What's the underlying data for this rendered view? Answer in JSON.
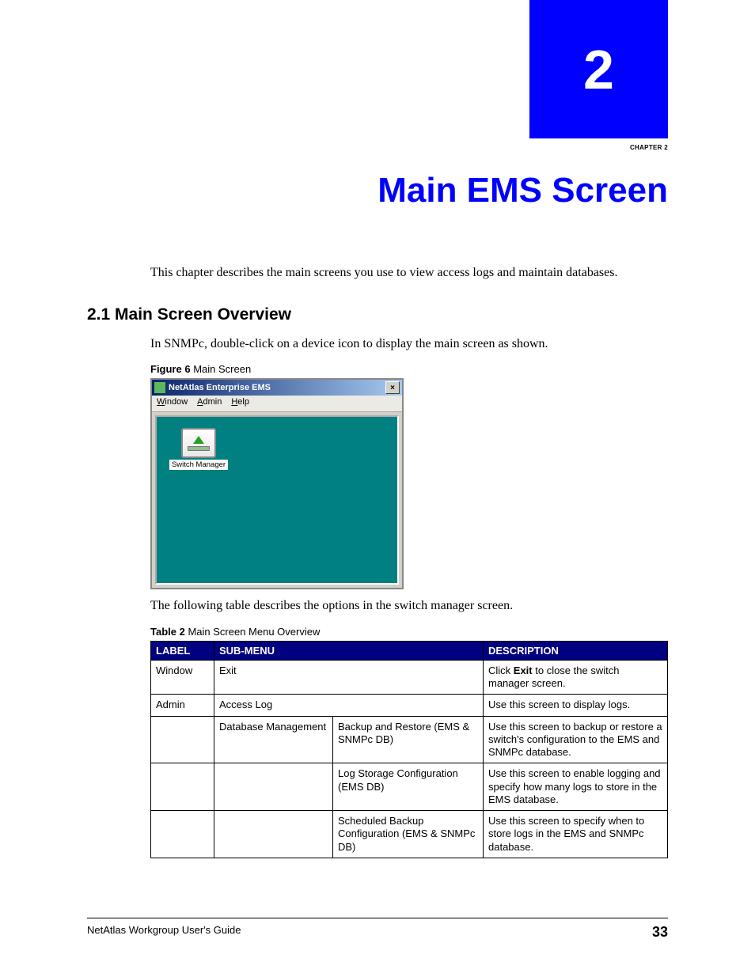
{
  "chapter": {
    "number": "2",
    "label": "CHAPTER  2",
    "title": "Main EMS Screen"
  },
  "intro": "This chapter describes the main screens you use to view access logs and maintain databases.",
  "section": {
    "number_title": "2.1  Main Screen Overview",
    "body1": "In SNMPc, double-click on a device icon to display the main screen as shown.",
    "body2": "The following table describes the options in the switch manager screen."
  },
  "figure": {
    "caption_prefix": "Figure 6",
    "caption_text": "   Main Screen",
    "window_title": "NetAtlas Enterprise EMS",
    "menu": {
      "m1": "Window",
      "m2": "Admin",
      "m3": "Help"
    },
    "icon_label": "Switch Manager",
    "close_glyph": "×"
  },
  "table": {
    "caption_prefix": "Table 2",
    "caption_text": "   Main Screen Menu Overview",
    "headers": {
      "h1": "LABEL",
      "h2": "SUB-MENU",
      "h3": "DESCRIPTION"
    },
    "rows": [
      {
        "label": "Window",
        "sub1": "Exit",
        "sub2": "",
        "desc_pre": "Click ",
        "desc_bold": "Exit",
        "desc_post": " to close the switch manager screen."
      },
      {
        "label": "Admin",
        "sub1": "Access Log",
        "sub2": "",
        "desc": "Use this screen to display logs."
      },
      {
        "label": "",
        "sub1": "Database Management",
        "sub2": "Backup and Restore (EMS & SNMPc DB)",
        "desc": "Use this screen to backup or restore a switch's configuration to the EMS and SNMPc database."
      },
      {
        "label": "",
        "sub1": "",
        "sub2": "Log Storage Configuration (EMS DB)",
        "desc": "Use this screen to enable logging and specify how many logs to store in the EMS database."
      },
      {
        "label": "",
        "sub1": "",
        "sub2": "Scheduled Backup Configuration (EMS & SNMPc DB)",
        "desc": "Use this screen to specify when to store logs in the EMS and SNMPc database."
      }
    ]
  },
  "footer": {
    "guide": "NetAtlas Workgroup User's Guide",
    "page": "33"
  }
}
